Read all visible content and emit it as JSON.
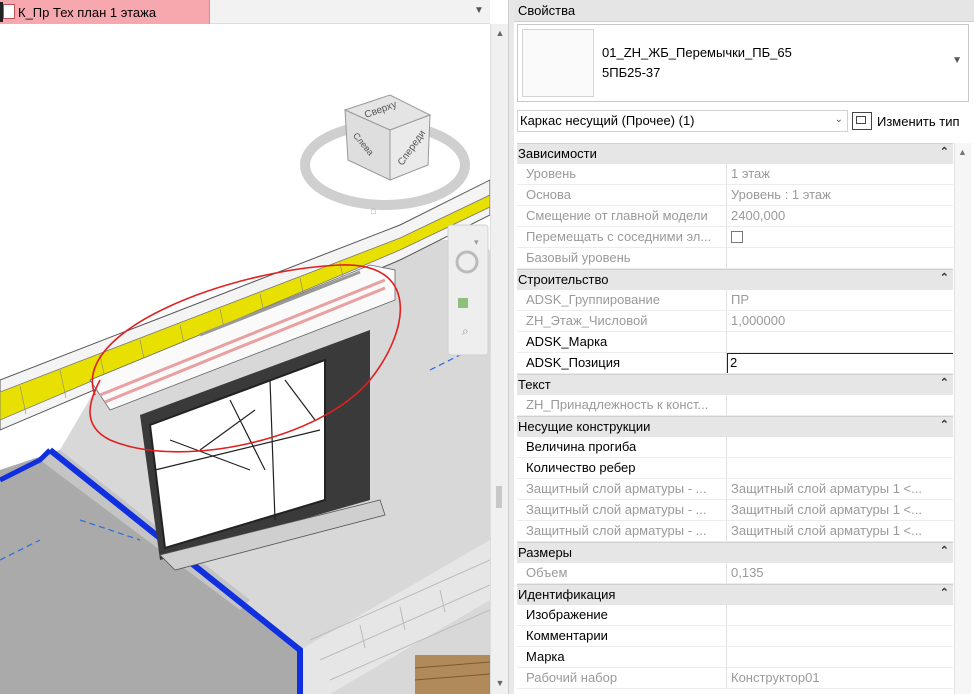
{
  "viewport": {
    "tab_title": "К_Пр Тех план 1 этажа",
    "viewcube": {
      "top_face": "Сверху",
      "front_face": "Спереди",
      "left_face": "Слева"
    }
  },
  "properties": {
    "title": "Свойства",
    "type_selector": {
      "name_line1": "01_ZH_ЖБ_Перемычки_ПБ_65",
      "name_line2": "5ПБ25-37"
    },
    "instance_filter": "Каркас несущий (Прочее) (1)",
    "edit_type_label": "Изменить тип",
    "groups": [
      {
        "name": "Зависимости",
        "rows": [
          {
            "name": "Уровень",
            "value": "1 этаж",
            "readonly": true
          },
          {
            "name": "Основа",
            "value": "Уровень : 1 этаж",
            "readonly": true
          },
          {
            "name": "Смещение от главной модели",
            "value": "2400,000",
            "readonly": true
          },
          {
            "name": "Перемещать с соседними эл...",
            "value": "",
            "checkbox": true,
            "readonly": true
          },
          {
            "name": "Базовый уровень",
            "value": "",
            "readonly": true
          }
        ]
      },
      {
        "name": "Строительство",
        "rows": [
          {
            "name": "ADSK_Группирование",
            "value": "ПР",
            "readonly": true
          },
          {
            "name": "ZH_Этаж_Числовой",
            "value": "1,000000",
            "readonly": true
          },
          {
            "name": "ADSK_Марка",
            "value": "",
            "readonly": false
          },
          {
            "name": "ADSK_Позиция",
            "value": "2",
            "readonly": false,
            "editing": true
          }
        ]
      },
      {
        "name": "Текст",
        "rows": [
          {
            "name": "ZH_Принадлежность к конст...",
            "value": "",
            "readonly": true
          }
        ]
      },
      {
        "name": "Несущие конструкции",
        "rows": [
          {
            "name": "Величина прогиба",
            "value": "",
            "readonly": false
          },
          {
            "name": "Количество ребер",
            "value": "",
            "readonly": false
          },
          {
            "name": "Защитный слой арматуры - ...",
            "value": "Защитный слой арматуры 1 <...",
            "readonly": true
          },
          {
            "name": "Защитный слой арматуры - ...",
            "value": "Защитный слой арматуры 1 <...",
            "readonly": true
          },
          {
            "name": "Защитный слой арматуры - ...",
            "value": "Защитный слой арматуры 1 <...",
            "readonly": true
          }
        ]
      },
      {
        "name": "Размеры",
        "rows": [
          {
            "name": "Объем",
            "value": "0,135",
            "readonly": true
          }
        ]
      },
      {
        "name": "Идентификация",
        "rows": [
          {
            "name": "Изображение",
            "value": "",
            "readonly": false
          },
          {
            "name": "Комментарии",
            "value": "",
            "readonly": false
          },
          {
            "name": "Марка",
            "value": "",
            "readonly": false
          },
          {
            "name": "Рабочий набор",
            "value": "Конструктор01",
            "readonly": true
          }
        ]
      }
    ]
  },
  "colors": {
    "tab_bg": "#f7a8ae",
    "annotation_red": "#e02020",
    "wall_blue": "#1030e0",
    "insulation_yellow": "#e8e000",
    "readonly_text": "#9a9a9a"
  }
}
